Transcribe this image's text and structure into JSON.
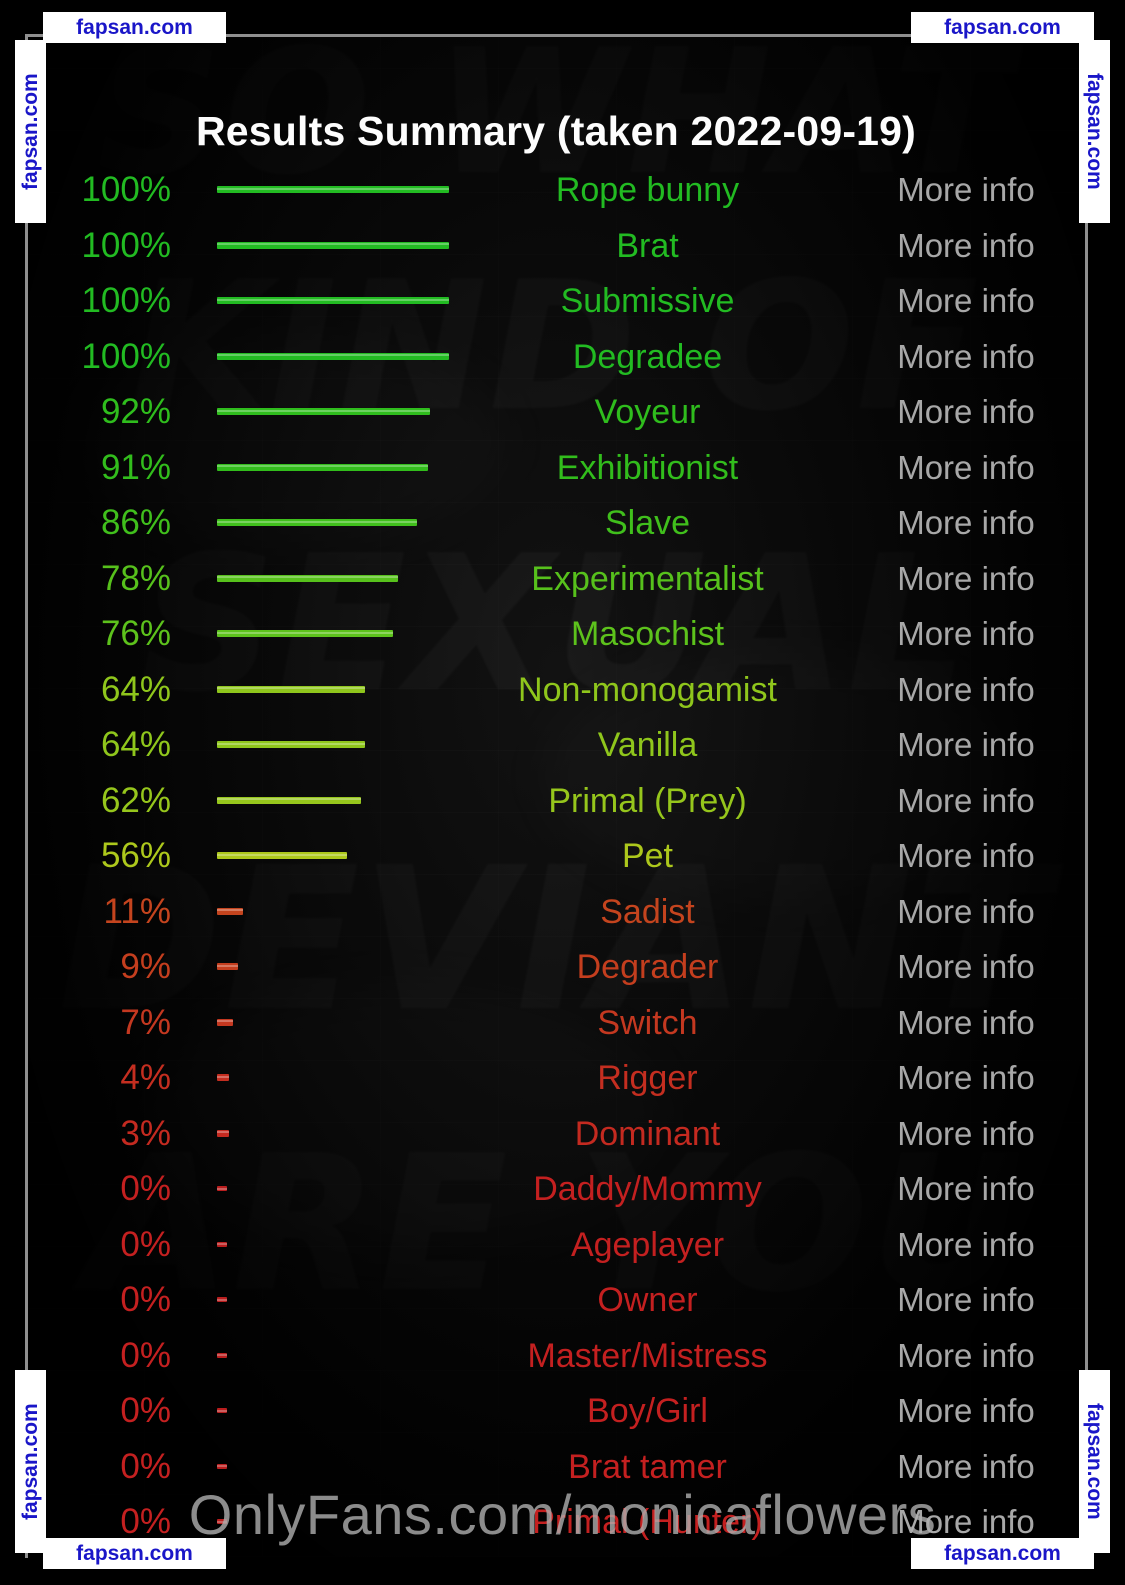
{
  "page": {
    "title": "Results Summary (taken 2022-09-19)",
    "info_label": "More info",
    "overlay_watermark": "OnlyFans.com/monicaflowers",
    "corner_watermark": "fapsan.com",
    "background_graffiti": [
      "SO WHAT",
      "KIND OF",
      "SEXUAL",
      "DEVIANT",
      "ARE YOU"
    ],
    "colors": {
      "background": "#000000",
      "title": "#fdfdfd",
      "info": "#a8a8a8",
      "frame": "#8f8f8f",
      "watermark_text": "#1a16c8",
      "watermark_bg": "#ffffff",
      "high": "#22bb22",
      "mid": "#9dc51c",
      "low": "#c4401e"
    }
  },
  "chart_data": {
    "type": "bar",
    "title": "Results Summary (taken 2022-09-19)",
    "xlabel": "",
    "ylabel": "",
    "xlim": [
      0,
      100
    ],
    "grid": false,
    "legend": null,
    "orientation": "horizontal",
    "unit": "%",
    "categories": [
      "Rope bunny",
      "Brat",
      "Submissive",
      "Degradee",
      "Voyeur",
      "Exhibitionist",
      "Slave",
      "Experimentalist",
      "Masochist",
      "Non-monogamist",
      "Vanilla",
      "Primal (Prey)",
      "Pet",
      "Sadist",
      "Degrader",
      "Switch",
      "Rigger",
      "Dominant",
      "Daddy/Mommy",
      "Ageplayer",
      "Owner",
      "Master/Mistress",
      "Boy/Girl",
      "Brat tamer",
      "Primal (Hunter)"
    ],
    "values": [
      100,
      100,
      100,
      100,
      92,
      91,
      86,
      78,
      76,
      64,
      64,
      62,
      56,
      11,
      9,
      7,
      4,
      3,
      0,
      0,
      0,
      0,
      0,
      0,
      0
    ]
  },
  "rows": [
    {
      "pct": "100%",
      "label": "Rope bunny",
      "value": 100,
      "color": "#22bb22",
      "info": "More info"
    },
    {
      "pct": "100%",
      "label": "Brat",
      "value": 100,
      "color": "#22bb22",
      "info": "More info"
    },
    {
      "pct": "100%",
      "label": "Submissive",
      "value": 100,
      "color": "#22bb22",
      "info": "More info"
    },
    {
      "pct": "100%",
      "label": "Degradee",
      "value": 100,
      "color": "#22bb22",
      "info": "More info"
    },
    {
      "pct": "92%",
      "label": "Voyeur",
      "value": 92,
      "color": "#2fbd1d",
      "info": "More info"
    },
    {
      "pct": "91%",
      "label": "Exhibitionist",
      "value": 91,
      "color": "#32bd1c",
      "info": "More info"
    },
    {
      "pct": "86%",
      "label": "Slave",
      "value": 86,
      "color": "#40bf1c",
      "info": "More info"
    },
    {
      "pct": "78%",
      "label": "Experimentalist",
      "value": 78,
      "color": "#57c11c",
      "info": "More info"
    },
    {
      "pct": "76%",
      "label": "Masochist",
      "value": 76,
      "color": "#5dc21c",
      "info": "More info"
    },
    {
      "pct": "64%",
      "label": "Non-monogamist",
      "value": 64,
      "color": "#8fc61c",
      "info": "More info"
    },
    {
      "pct": "64%",
      "label": "Vanilla",
      "value": 64,
      "color": "#8fc61c",
      "info": "More info"
    },
    {
      "pct": "62%",
      "label": "Primal (Prey)",
      "value": 62,
      "color": "#96c61c",
      "info": "More info"
    },
    {
      "pct": "56%",
      "label": "Pet",
      "value": 56,
      "color": "#adc81c",
      "info": "More info"
    },
    {
      "pct": "11%",
      "label": "Sadist",
      "value": 11,
      "color": "#c4441e",
      "info": "More info"
    },
    {
      "pct": "9%",
      "label": "Degrader",
      "value": 9,
      "color": "#c43e1e",
      "info": "More info"
    },
    {
      "pct": "7%",
      "label": "Switch",
      "value": 7,
      "color": "#c43820",
      "info": "More info"
    },
    {
      "pct": "4%",
      "label": "Rigger",
      "value": 4,
      "color": "#c42e20",
      "info": "More info"
    },
    {
      "pct": "3%",
      "label": "Dominant",
      "value": 3,
      "color": "#c42a20",
      "info": "More info"
    },
    {
      "pct": "0%",
      "label": "Daddy/Mommy",
      "value": 0,
      "color": "#c42020",
      "info": "More info"
    },
    {
      "pct": "0%",
      "label": "Ageplayer",
      "value": 0,
      "color": "#c42020",
      "info": "More info"
    },
    {
      "pct": "0%",
      "label": "Owner",
      "value": 0,
      "color": "#c42020",
      "info": "More info"
    },
    {
      "pct": "0%",
      "label": "Master/Mistress",
      "value": 0,
      "color": "#c42020",
      "info": "More info"
    },
    {
      "pct": "0%",
      "label": "Boy/Girl",
      "value": 0,
      "color": "#c42020",
      "info": "More info"
    },
    {
      "pct": "0%",
      "label": "Brat tamer",
      "value": 0,
      "color": "#c42020",
      "info": "More info"
    },
    {
      "pct": "0%",
      "label": "Primal (Hunter)",
      "value": 0,
      "color": "#c42020",
      "info": "More info"
    }
  ]
}
